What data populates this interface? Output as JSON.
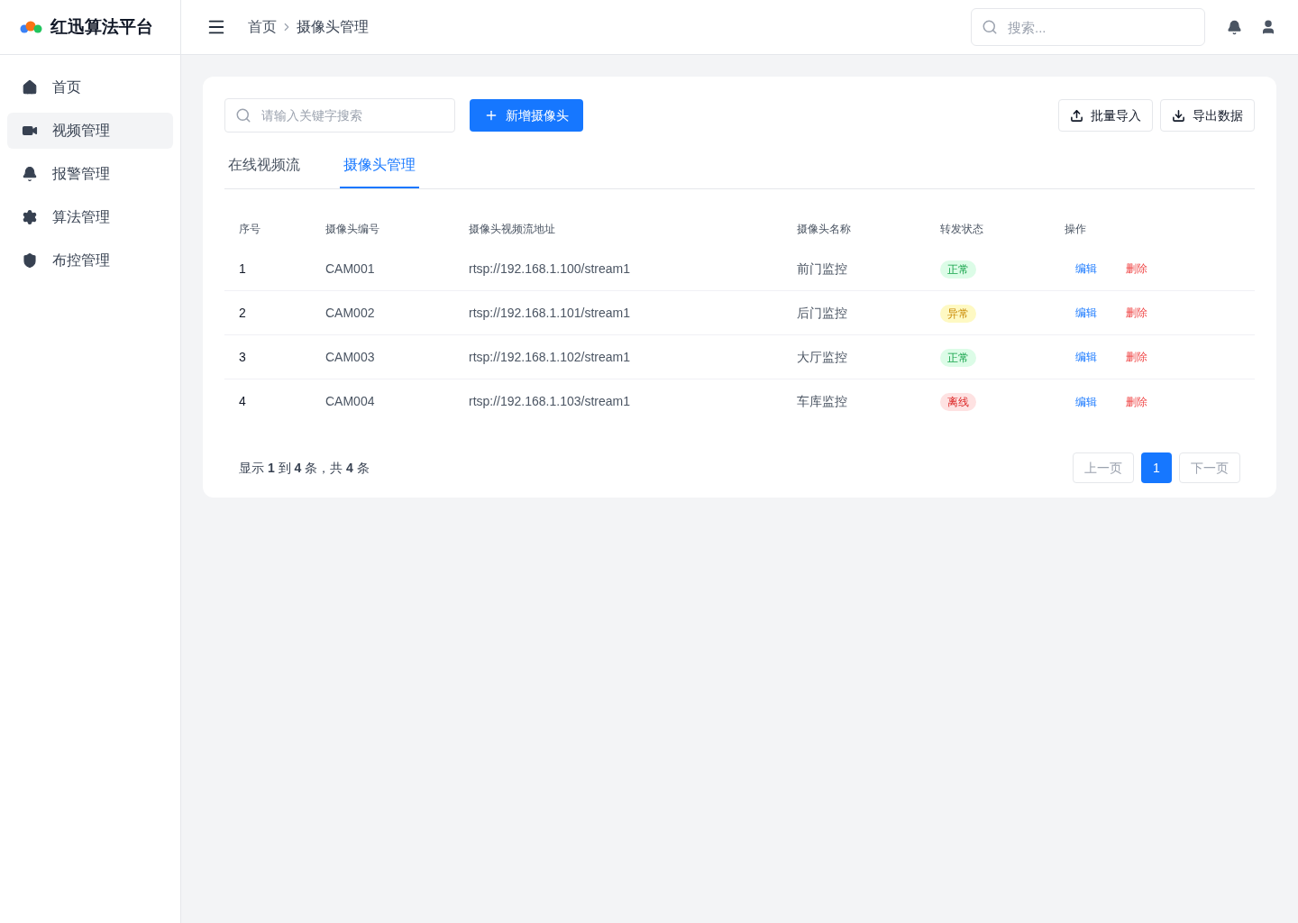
{
  "brand": {
    "name": "红迅算法平台"
  },
  "sidebar": {
    "items": [
      {
        "label": "首页",
        "kind": "home",
        "selected": false
      },
      {
        "label": "视频管理",
        "kind": "video",
        "selected": true
      },
      {
        "label": "报警管理",
        "kind": "alarm",
        "selected": false
      },
      {
        "label": "算法管理",
        "kind": "algorithm",
        "selected": false
      },
      {
        "label": "布控管理",
        "kind": "control",
        "selected": false
      }
    ]
  },
  "header": {
    "breadcrumb": [
      "首页",
      "摄像头管理"
    ],
    "search": {
      "placeholder": "搜索..."
    }
  },
  "toolbar": {
    "search": {
      "placeholder": "请输入关键字搜索"
    },
    "add_button": "新增摄像头",
    "import_button": "批量导入",
    "export_button": "导出数据"
  },
  "tabs": [
    {
      "label": "在线视频流",
      "selected": false
    },
    {
      "label": "摄像头管理",
      "selected": true
    }
  ],
  "table": {
    "columns": [
      "序号",
      "摄像头编号",
      "摄像头视频流地址",
      "摄像头名称",
      "转发状态",
      "操作"
    ],
    "rows": [
      {
        "index": "1",
        "code": "CAM001",
        "url": "rtsp://192.168.1.100/stream1",
        "name": "前门监控",
        "status": {
          "label": "正常",
          "kind": "ok"
        },
        "actions": [
          "编辑",
          "删除"
        ]
      },
      {
        "index": "2",
        "code": "CAM002",
        "url": "rtsp://192.168.1.101/stream1",
        "name": "后门监控",
        "status": {
          "label": "异常",
          "kind": "warning"
        },
        "actions": [
          "编辑",
          "删除"
        ]
      },
      {
        "index": "3",
        "code": "CAM003",
        "url": "rtsp://192.168.1.102/stream1",
        "name": "大厅监控",
        "status": {
          "label": "正常",
          "kind": "ok"
        },
        "actions": [
          "编辑",
          "删除"
        ]
      },
      {
        "index": "4",
        "code": "CAM004",
        "url": "rtsp://192.168.1.103/stream1",
        "name": "车库监控",
        "status": {
          "label": "离线",
          "kind": "offline"
        },
        "actions": [
          "编辑",
          "删除"
        ]
      }
    ]
  },
  "pagination": {
    "summary": "显示 **1** 到 **4** 条，共 **4** 条",
    "prev": {
      "label": "上一页",
      "disabled": true
    },
    "pages": [
      {
        "label": "1",
        "selected": true
      }
    ],
    "next": {
      "label": "下一页",
      "disabled": true
    }
  }
}
